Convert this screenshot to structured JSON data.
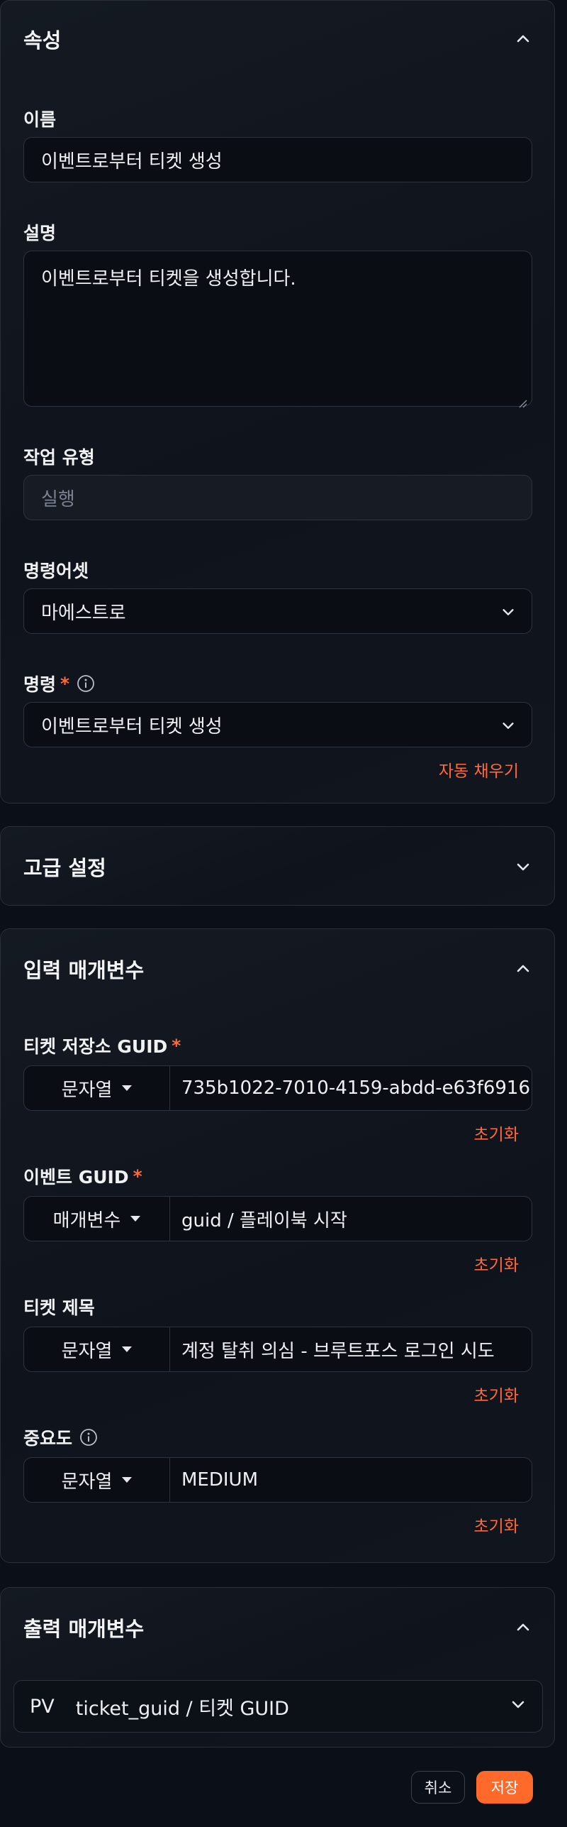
{
  "properties": {
    "title": "속성",
    "name_label": "이름",
    "name_value": "이벤트로부터 티켓 생성",
    "description_label": "설명",
    "description_value": "이벤트로부터 티켓을 생성합니다.",
    "task_type_label": "작업 유형",
    "task_type_value": "실행",
    "command_asset_label": "명령어셋",
    "command_asset_value": "마에스트로",
    "command_label": "명령",
    "command_required": "*",
    "command_value": "이벤트로부터 티켓 생성",
    "autofill_label": "자동 채우기"
  },
  "advanced": {
    "title": "고급 설정"
  },
  "inputs": {
    "title": "입력 매개변수",
    "reset_label": "초기화",
    "params": [
      {
        "label": "티켓 저장소 GUID",
        "required": "*",
        "type": "문자열",
        "value": "735b1022-7010-4159-abdd-e63f6916"
      },
      {
        "label": "이벤트 GUID",
        "required": "*",
        "type": "매개변수",
        "value": "guid / 플레이북 시작"
      },
      {
        "label": "티켓 제목",
        "required": "",
        "type": "문자열",
        "value": "계정 탈취 의심 - 브루트포스 로그인 시도"
      },
      {
        "label": "중요도",
        "required": "",
        "type": "문자열",
        "value": "MEDIUM"
      }
    ]
  },
  "outputs": {
    "title": "출력 매개변수",
    "row_prefix": "PV",
    "row_value": "ticket_guid / 티켓 GUID"
  },
  "footer": {
    "cancel_label": "취소",
    "save_label": "저장"
  },
  "colors": {
    "accent": "#ff6a2a",
    "background": "#0b0f17",
    "panel": "#131821"
  }
}
